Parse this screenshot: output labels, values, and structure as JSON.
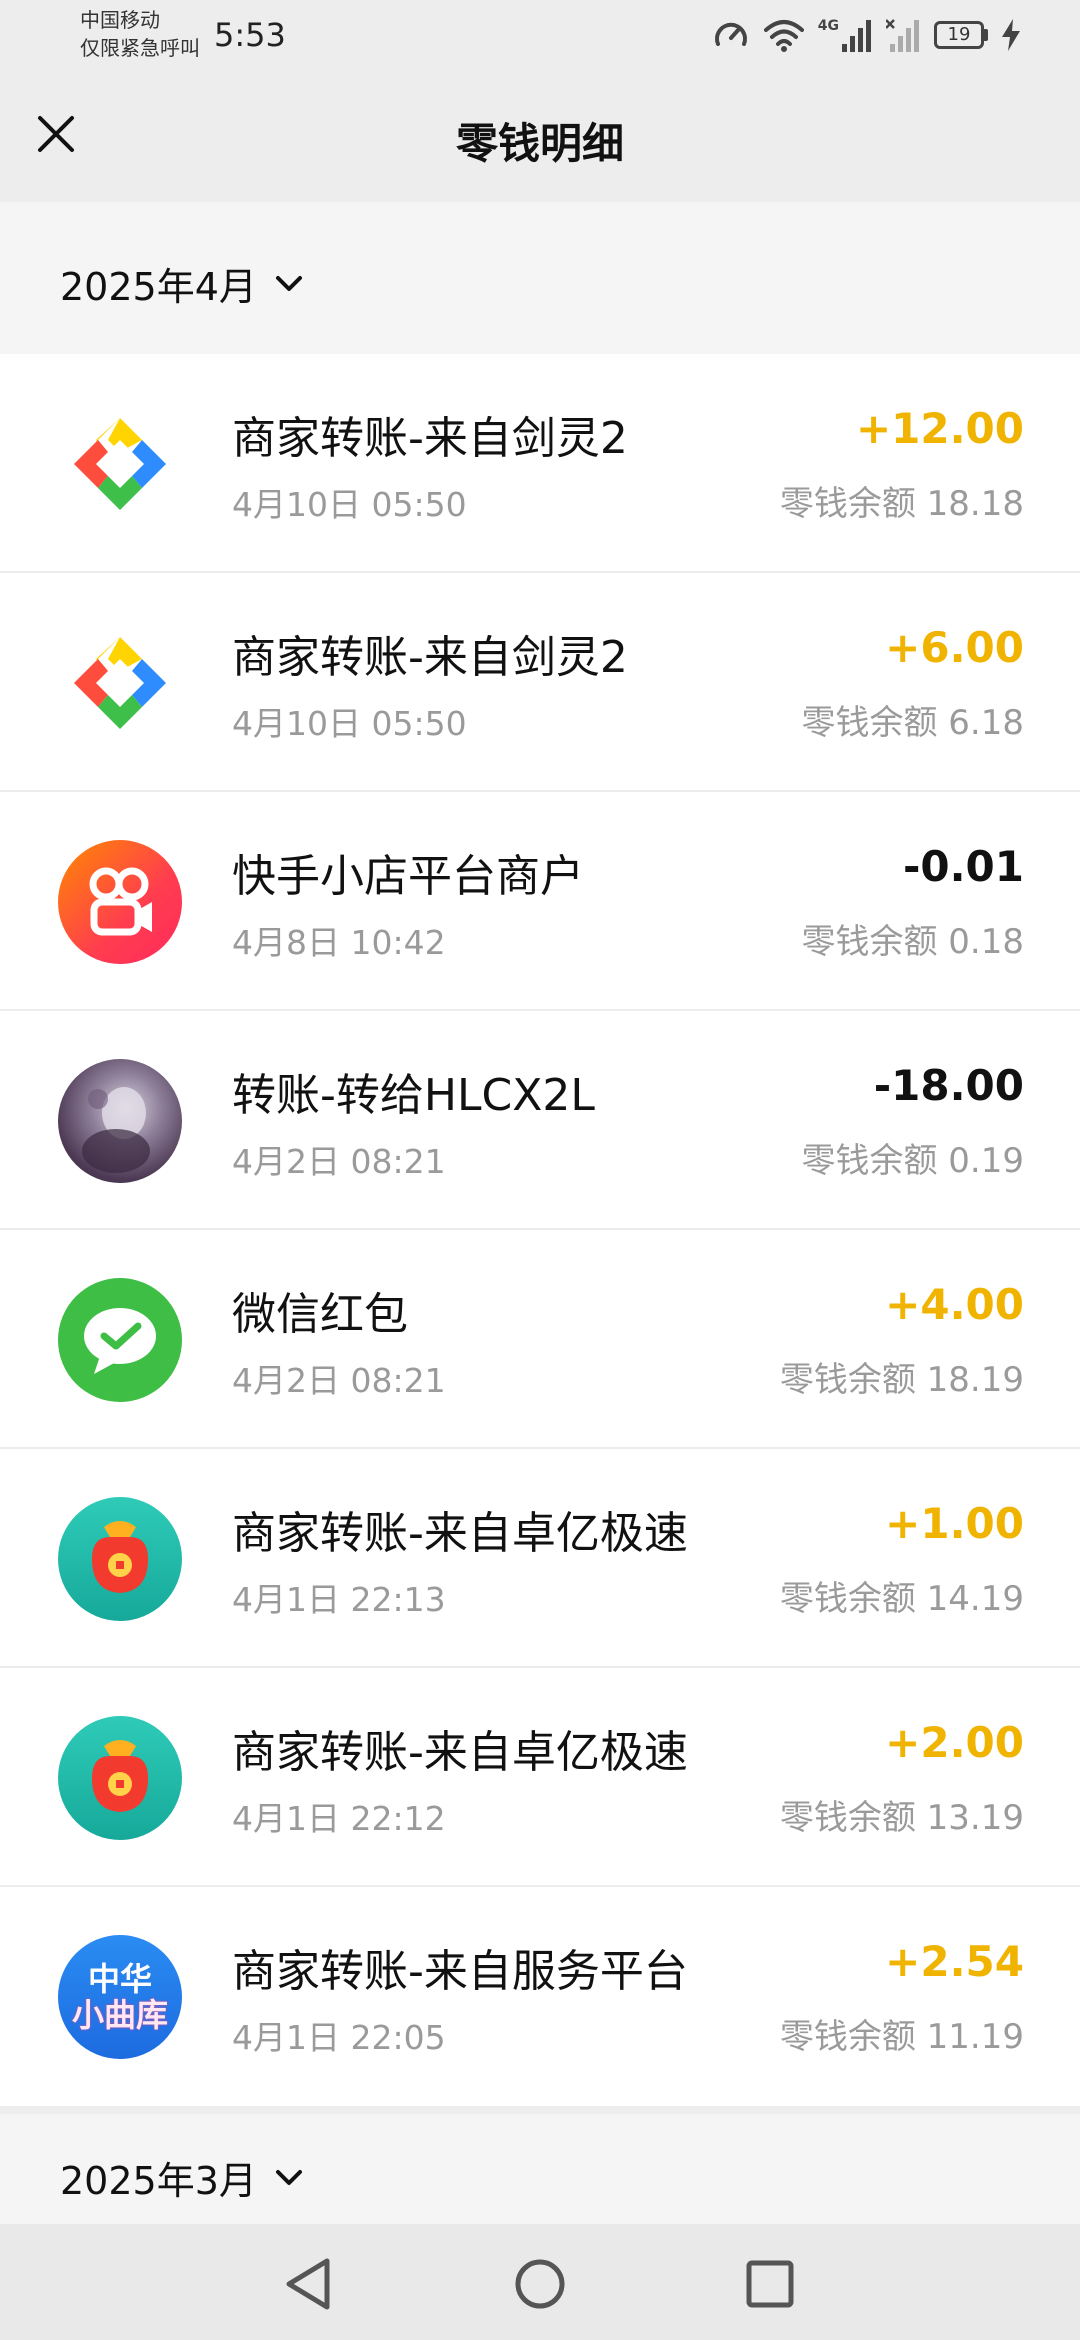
{
  "status_bar": {
    "carrier_line1": "中国移动",
    "carrier_line2": "仅限紧急呼叫",
    "time": "5:53",
    "network_label": "4G",
    "battery_level": "19"
  },
  "header": {
    "title": "零钱明细",
    "close_icon": "close-icon"
  },
  "months": [
    {
      "label": "2025年4月"
    },
    {
      "label": "2025年3月"
    }
  ],
  "transactions": [
    {
      "icon": "colorful-logo-icon",
      "title": "商家转账-来自剑灵2",
      "time": "4月10日 05:50",
      "amount": "+12.00",
      "direction": "in",
      "balance_label": "零钱余额",
      "balance": "18.18"
    },
    {
      "icon": "colorful-logo-icon",
      "title": "商家转账-来自剑灵2",
      "time": "4月10日 05:50",
      "amount": "+6.00",
      "direction": "in",
      "balance_label": "零钱余额",
      "balance": "6.18"
    },
    {
      "icon": "kuaishou-icon",
      "title": "快手小店平台商户",
      "time": "4月8日 10:42",
      "amount": "-0.01",
      "direction": "out",
      "balance_label": "零钱余额",
      "balance": "0.18"
    },
    {
      "icon": "avatar-icon",
      "title": "转账-转给HLCX2L",
      "time": "4月2日 08:21",
      "amount": "-18.00",
      "direction": "out",
      "balance_label": "零钱余额",
      "balance": "0.19"
    },
    {
      "icon": "wechat-icon",
      "title": "微信红包",
      "time": "4月2日 08:21",
      "amount": "+4.00",
      "direction": "in",
      "balance_label": "零钱余额",
      "balance": "18.19"
    },
    {
      "icon": "red-bag-icon",
      "title": "商家转账-来自卓亿极速",
      "time": "4月1日 22:13",
      "amount": "+1.00",
      "direction": "in",
      "balance_label": "零钱余额",
      "balance": "14.19"
    },
    {
      "icon": "red-bag-icon",
      "title": "商家转账-来自卓亿极速",
      "time": "4月1日 22:12",
      "amount": "+2.00",
      "direction": "in",
      "balance_label": "零钱余额",
      "balance": "13.19"
    },
    {
      "icon": "music-library-icon",
      "icon_text_line1": "中华",
      "icon_text_line2": "小曲库",
      "title": "商家转账-来自服务平台",
      "time": "4月1日 22:05",
      "amount": "+2.54",
      "direction": "in",
      "balance_label": "零钱余额",
      "balance": "11.19"
    }
  ],
  "colors": {
    "income": "#f0b400",
    "expense": "#111111",
    "secondary_text": "#9a9a9a",
    "page_background": "#ededed"
  },
  "nav_bar": {
    "back_icon": "nav-back-icon",
    "home_icon": "nav-home-icon",
    "recent_icon": "nav-recent-icon"
  }
}
